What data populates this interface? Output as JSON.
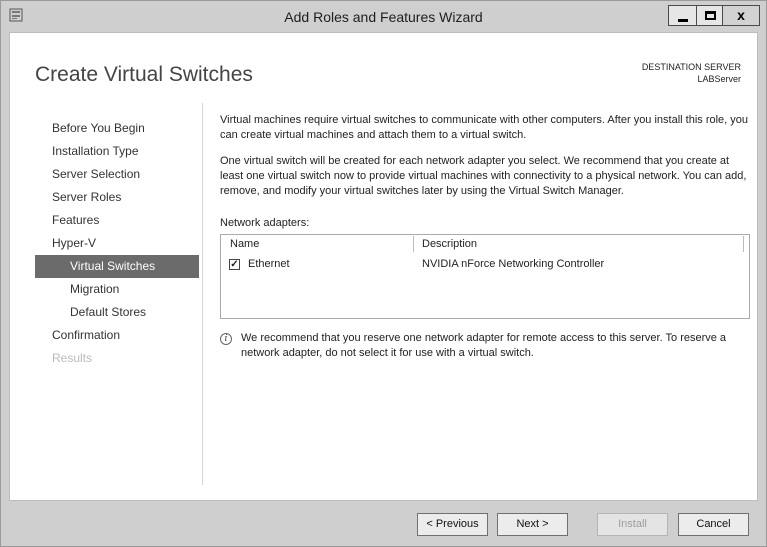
{
  "window": {
    "title": "Add Roles and Features Wizard"
  },
  "page": {
    "title": "Create Virtual Switches",
    "destination_label": "DESTINATION SERVER",
    "destination_server": "LABServer"
  },
  "nav": [
    {
      "label": "Before You Begin",
      "level": 0,
      "state": "normal"
    },
    {
      "label": "Installation Type",
      "level": 0,
      "state": "normal"
    },
    {
      "label": "Server Selection",
      "level": 0,
      "state": "normal"
    },
    {
      "label": "Server Roles",
      "level": 0,
      "state": "normal"
    },
    {
      "label": "Features",
      "level": 0,
      "state": "normal"
    },
    {
      "label": "Hyper-V",
      "level": 0,
      "state": "normal"
    },
    {
      "label": "Virtual Switches",
      "level": 1,
      "state": "active"
    },
    {
      "label": "Migration",
      "level": 1,
      "state": "normal"
    },
    {
      "label": "Default Stores",
      "level": 1,
      "state": "normal"
    },
    {
      "label": "Confirmation",
      "level": 0,
      "state": "normal"
    },
    {
      "label": "Results",
      "level": 0,
      "state": "disabled"
    }
  ],
  "main": {
    "intro": "Virtual machines require virtual switches to communicate with other computers. After you install this role, you can create virtual machines and attach them to a virtual switch.",
    "detail": "One virtual switch will be created for each network adapter you select. We recommend that you create at least one virtual switch now to provide virtual machines with connectivity to a physical network. You can add, remove, and modify your virtual switches later by using the Virtual Switch Manager.",
    "adapters_label": "Network adapters:",
    "columns": {
      "name": "Name",
      "description": "Description"
    },
    "adapters": [
      {
        "checked": true,
        "name": "Ethernet",
        "description": "NVIDIA nForce Networking Controller"
      }
    ],
    "note": "We recommend that you reserve one network adapter for remote access to this server. To reserve a network adapter, do not select it for use with a virtual switch."
  },
  "footer": {
    "previous": "< Previous",
    "next": "Next >",
    "install": "Install",
    "cancel": "Cancel"
  }
}
